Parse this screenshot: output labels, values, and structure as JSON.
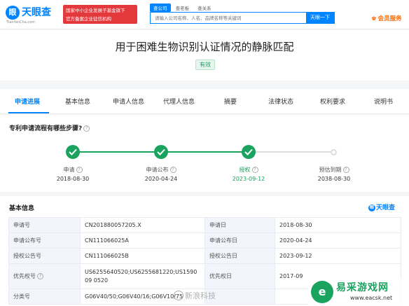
{
  "header": {
    "logo_text": "天眼查",
    "logo_sub": "TianYanCha.com",
    "banner_line1": "国家中小企业发展子基金旗下",
    "banner_line2": "官方备案企业征信机构",
    "search_tabs": [
      "查公司",
      "查老板",
      "查关系"
    ],
    "search_placeholder": "请输入公司名称、人名、品牌名称等关键词",
    "search_button": "天眼一下",
    "vip_label": "会员服务"
  },
  "patent": {
    "title": "用于困难生物识别认证情况的静脉匹配",
    "status": "有效"
  },
  "tabs": [
    "申请进展",
    "基本信息",
    "申请人信息",
    "代理人信息",
    "摘要",
    "法律状态",
    "权利要求",
    "说明书"
  ],
  "flow": {
    "title": "专利申请流程有哪些步骤?",
    "steps": [
      {
        "name": "申请",
        "date": "2018-08-30"
      },
      {
        "name": "申请公布",
        "date": "2020-04-24"
      },
      {
        "name": "授权",
        "date": "2023-09-12"
      },
      {
        "name": "预估到期",
        "date": "2038-08-30"
      }
    ]
  },
  "info": {
    "title": "基本信息",
    "logo_text": "天眼查",
    "rows": [
      {
        "k1": "申请号",
        "v1": "CN201880057205.X",
        "k2": "申请日",
        "v2": "2018-08-30"
      },
      {
        "k1": "申请公布号",
        "v1": "CN111066025A",
        "k2": "申请公布日",
        "v2": "2020-04-24"
      },
      {
        "k1": "授权公告号",
        "v1": "CN111066025B",
        "k2": "授权公告日",
        "v2": "2023-09-12"
      },
      {
        "k1": "优先权号",
        "v1": "US6255640520;US6255681220;US159009 0520",
        "k2": "优先权日",
        "v2": "2017-09"
      },
      {
        "k1": "分类号",
        "v1": "G06V40/50;G06V40/16;G06V10/75",
        "k2": "",
        "v2": ""
      }
    ]
  },
  "watermark": {
    "center": "新浪科技",
    "site_name": "易采游戏网",
    "site_url": "www.eacsk.net"
  }
}
